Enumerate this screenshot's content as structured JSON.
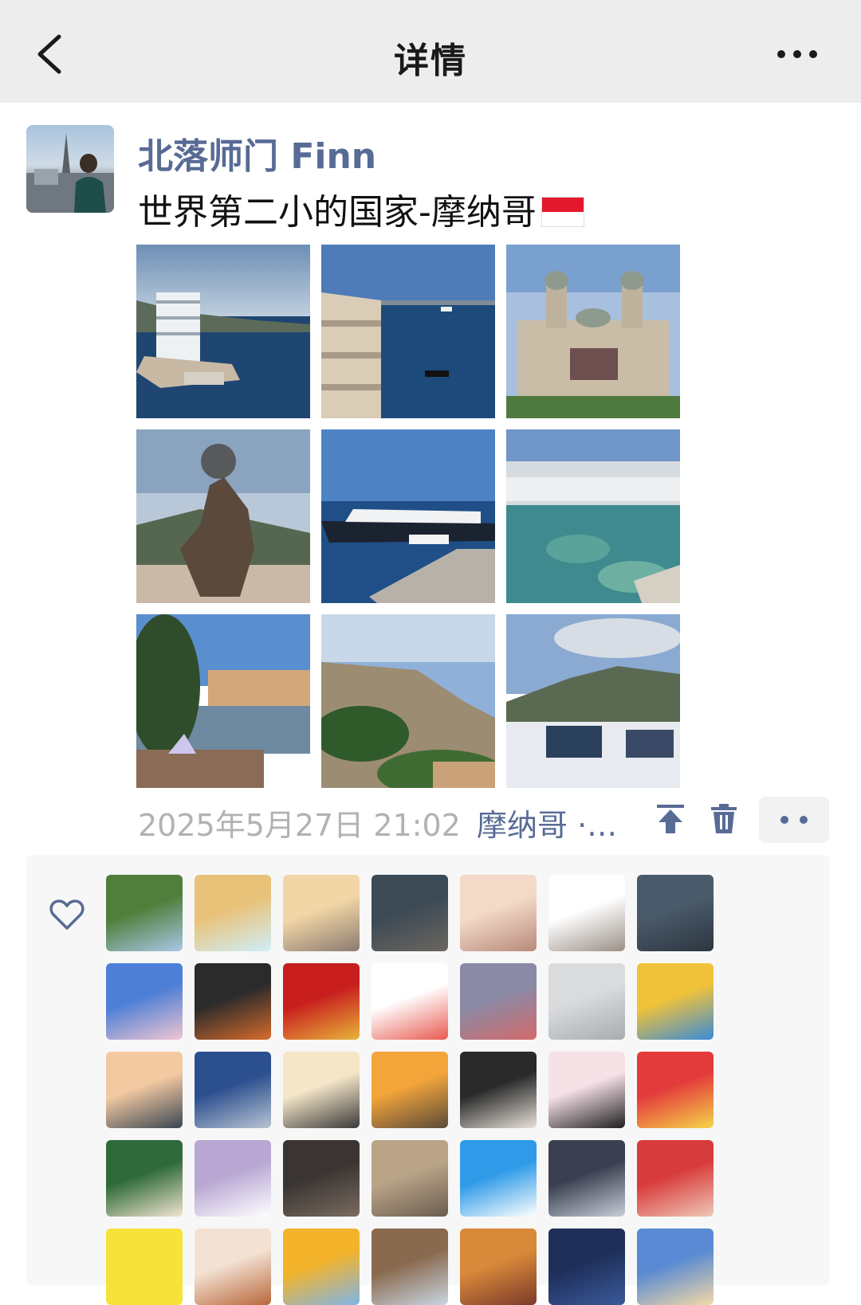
{
  "nav": {
    "title": "详情",
    "back_icon": "chevron-left-icon",
    "more_icon": "more-dots-icon"
  },
  "post": {
    "username": "北落师门 Finn",
    "text": "世界第二小的国家-摩纳哥",
    "flag_icon": "monaco-flag-icon",
    "photos": [
      {
        "name": "photo-harbor-building"
      },
      {
        "name": "photo-sea-balcony"
      },
      {
        "name": "photo-casino"
      },
      {
        "name": "photo-hand-sculpture"
      },
      {
        "name": "photo-cruise-ship"
      },
      {
        "name": "photo-marina-clear-water"
      },
      {
        "name": "photo-port-view"
      },
      {
        "name": "photo-rock-cliff"
      },
      {
        "name": "photo-boats-hills"
      }
    ],
    "timestamp": "2025年5月27日 21:02",
    "location": "摩纳哥 ·…"
  },
  "actions": {
    "pin_icon": "pin-top-icon",
    "delete_icon": "trash-icon",
    "more_icon": "more-dots-icon"
  },
  "likes": {
    "heart_icon": "heart-icon",
    "avatars": [
      {
        "name": "liker-avatar-mountains",
        "c1": "#4f7f3b",
        "c2": "#a9c7e8"
      },
      {
        "name": "liker-avatar-bear",
        "c1": "#e9c27a",
        "c2": "#cfeff8"
      },
      {
        "name": "liker-avatar-icecream",
        "c1": "#f3d6a6",
        "c2": "#8a7b6f"
      },
      {
        "name": "liker-avatar-dark-room",
        "c1": "#3c4a55",
        "c2": "#6b6660"
      },
      {
        "name": "liker-avatar-baby",
        "c1": "#f3d9c8",
        "c2": "#b8897a"
      },
      {
        "name": "liker-avatar-cat-cartoon",
        "c1": "#ffffff",
        "c2": "#9a8f86"
      },
      {
        "name": "liker-avatar-man",
        "c1": "#4a5a6a",
        "c2": "#2c3640"
      },
      {
        "name": "liker-avatar-pig",
        "c1": "#4e7fd6",
        "c2": "#f1c6d2"
      },
      {
        "name": "liker-avatar-basketball",
        "c1": "#2b2b2b",
        "c2": "#d96b2b"
      },
      {
        "name": "liker-avatar-red-badge",
        "c1": "#c81e1e",
        "c2": "#e8b43a"
      },
      {
        "name": "liker-avatar-girl-cartoon",
        "c1": "#ffffff",
        "c2": "#e85a4f"
      },
      {
        "name": "liker-avatar-lady",
        "c1": "#8a8aa6",
        "c2": "#d46a6a"
      },
      {
        "name": "liker-avatar-foggy",
        "c1": "#d9dbdd",
        "c2": "#a7acb0"
      },
      {
        "name": "liker-avatar-powerpuff",
        "c1": "#f0c23a",
        "c2": "#3a8bd9"
      },
      {
        "name": "liker-avatar-beach-girl",
        "c1": "#f3c9a1",
        "c2": "#3a4652"
      },
      {
        "name": "liker-avatar-football",
        "c1": "#2c4f8f",
        "c2": "#b8c4d3"
      },
      {
        "name": "liker-avatar-anime-girl",
        "c1": "#f5e6c8",
        "c2": "#3a3a3a"
      },
      {
        "name": "liker-avatar-sunset",
        "c1": "#f3a53a",
        "c2": "#5a4a3a"
      },
      {
        "name": "liker-avatar-cat-photo",
        "c1": "#2a2a2a",
        "c2": "#e8e2da"
      },
      {
        "name": "liker-avatar-bow-girl",
        "c1": "#f6e1e7",
        "c2": "#1f1f1f"
      },
      {
        "name": "liker-avatar-arale",
        "c1": "#e33b3b",
        "c2": "#f5d54a"
      },
      {
        "name": "liker-avatar-food",
        "c1": "#2f6b3a",
        "c2": "#f1e4d0"
      },
      {
        "name": "liker-avatar-lilac-girl",
        "c1": "#b8a6d3",
        "c2": "#ffffff"
      },
      {
        "name": "liker-avatar-dark-cat",
        "c1": "#3a3532",
        "c2": "#7a6b60"
      },
      {
        "name": "liker-avatar-tabby",
        "c1": "#b9a488",
        "c2": "#6b5c4e"
      },
      {
        "name": "liker-avatar-blue-sketch",
        "c1": "#2f9be8",
        "c2": "#ffffff"
      },
      {
        "name": "liker-avatar-silhouette",
        "c1": "#3a4050",
        "c2": "#c7cfd9"
      },
      {
        "name": "liker-avatar-red-glasses",
        "c1": "#d83b3b",
        "c2": "#f0c8b8"
      },
      {
        "name": "liker-avatar-pikachu",
        "c1": "#f7e23a",
        "c2": "#f7e23a"
      },
      {
        "name": "liker-avatar-chibi",
        "c1": "#f3e1d3",
        "c2": "#b8673a"
      },
      {
        "name": "liker-avatar-sunflower",
        "c1": "#f3b32a",
        "c2": "#7fb5e8"
      },
      {
        "name": "liker-avatar-cliff",
        "c1": "#8a6a4f",
        "c2": "#c9d6e3"
      },
      {
        "name": "liker-avatar-autumn",
        "c1": "#d9893a",
        "c2": "#7a3a2a"
      },
      {
        "name": "liker-avatar-night-sky",
        "c1": "#1f2f5a",
        "c2": "#3a5a9a"
      },
      {
        "name": "liker-avatar-horizon",
        "c1": "#5a8ad3",
        "c2": "#f3d9a6"
      }
    ]
  }
}
